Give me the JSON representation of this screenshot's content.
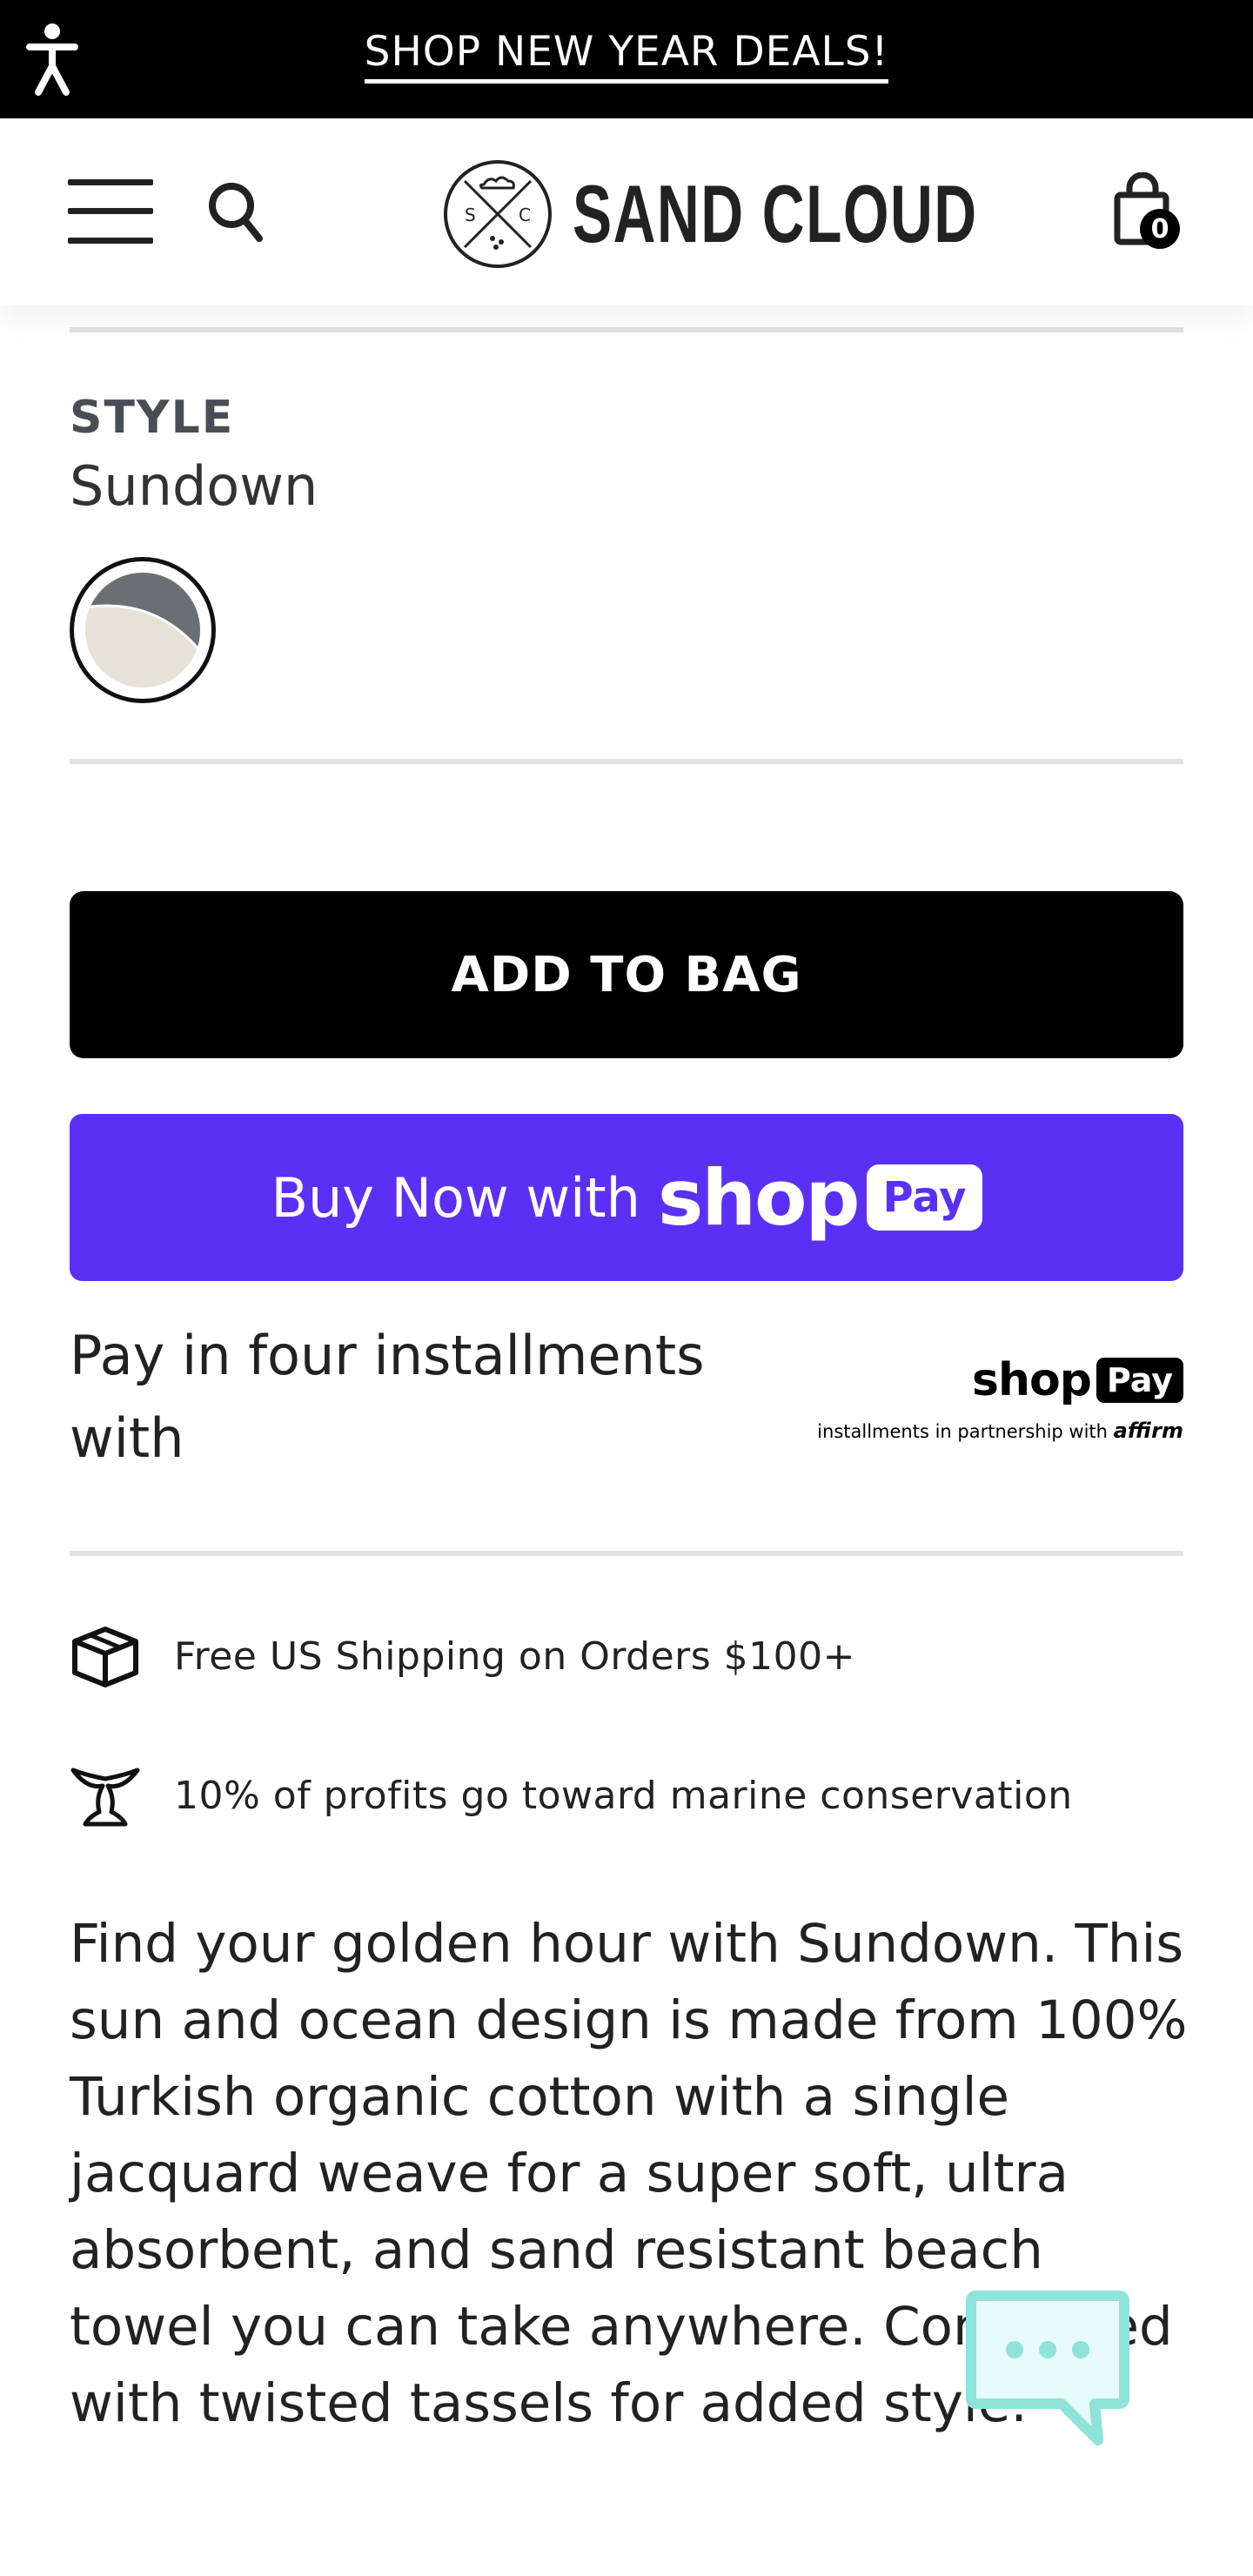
{
  "promo": {
    "text": "SHOP NEW YEAR DEALS!"
  },
  "header": {
    "logo_text": "SAND CLOUD",
    "cart_count": "0"
  },
  "product": {
    "style_label": "STYLE",
    "style_value": "Sundown",
    "add_to_bag_label": "ADD TO BAG",
    "buy_now_label": "Buy Now with",
    "buy_now_shop": "shop",
    "buy_now_pay": "Pay",
    "installments_text": "Pay in four installments with",
    "shop_pay_badge": {
      "shop": "shop",
      "pay": "Pay",
      "subtext": "installments in partnership with",
      "affirm": "affirm"
    }
  },
  "features": [
    {
      "icon": "box-icon",
      "text": "Free US Shipping on Orders $100+"
    },
    {
      "icon": "whale-tail-icon",
      "text": "10% of profits go toward marine conservation"
    }
  ],
  "description": "Find your golden hour with Sundown. This sun and ocean design is made from 100% Turkish organic cotton with a single jacquard weave for a super soft, ultra absorbent, and sand resistant beach towel you can take anywhere. Completed with twisted tassels for added style.",
  "colors": {
    "brand_purple": "#5a31f4",
    "black": "#000000",
    "chat_teal": "#8fe3d8",
    "divider": "#e1e1e6"
  }
}
